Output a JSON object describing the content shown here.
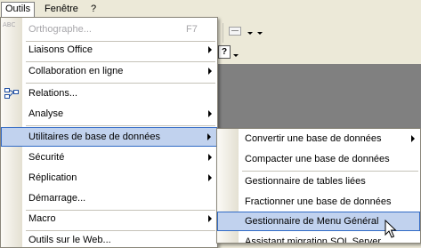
{
  "menubar": {
    "items": [
      {
        "label": "Outils"
      },
      {
        "label": "Fenêtre"
      },
      {
        "label": "?"
      }
    ]
  },
  "toolbar": {
    "help_label": "?"
  },
  "menu": {
    "items": [
      {
        "label": "Orthographe...",
        "shortcut": "F7",
        "icon": "spelling-abc-icon"
      },
      {
        "label": "Liaisons Office"
      },
      {
        "label": "Collaboration en ligne"
      },
      {
        "label": "Relations...",
        "icon": "relationships-icon"
      },
      {
        "label": "Analyse"
      },
      {
        "label": "Utilitaires de base de données"
      },
      {
        "label": "Sécurité"
      },
      {
        "label": "Réplication"
      },
      {
        "label": "Démarrage..."
      },
      {
        "label": "Macro"
      },
      {
        "label": "Outils sur le Web..."
      }
    ]
  },
  "submenu": {
    "items": [
      {
        "label": "Convertir une base de données"
      },
      {
        "label": "Compacter une base de données"
      },
      {
        "label": "Gestionnaire de tables liées"
      },
      {
        "label": "Fractionner une base de données"
      },
      {
        "label": "Gestionnaire de Menu Général"
      },
      {
        "label": "Assistant migration SQL Server"
      }
    ]
  },
  "colors": {
    "highlight_bg": "#c1d2ee",
    "highlight_border": "#316ac5",
    "document_area": "#808080",
    "chrome": "#ece9d8"
  }
}
